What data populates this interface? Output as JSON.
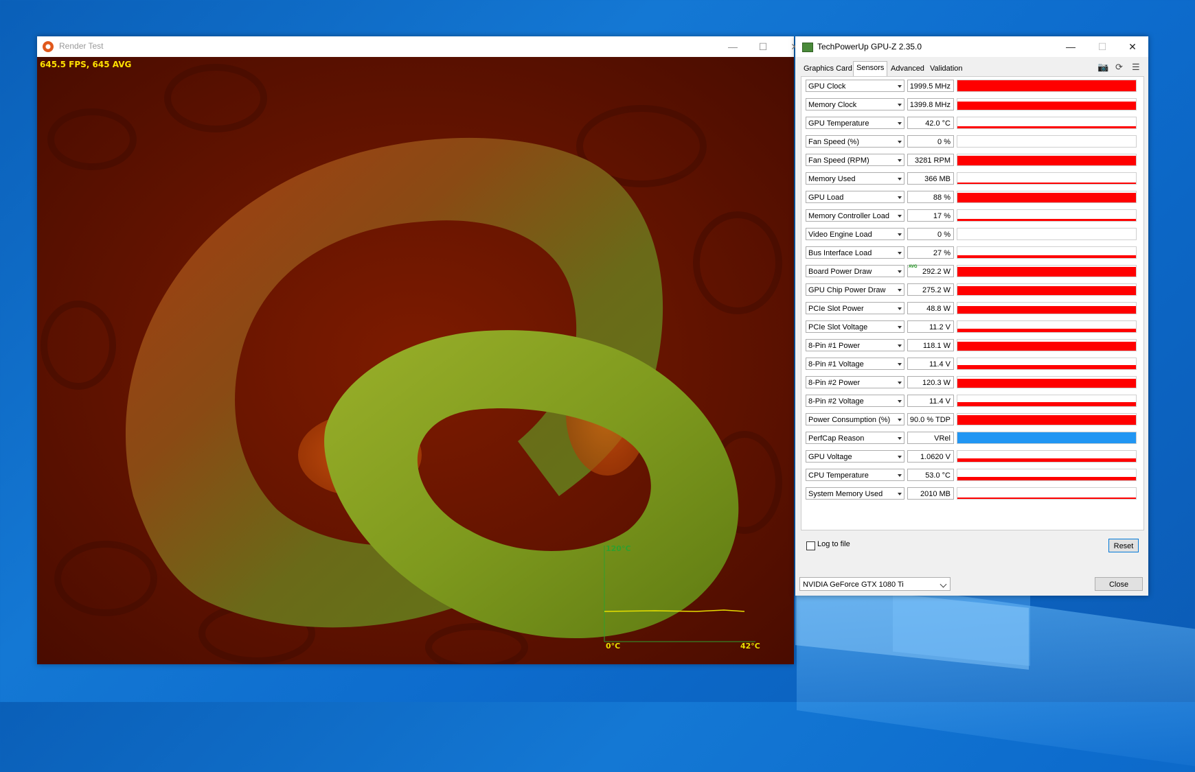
{
  "render_window": {
    "title": "Render Test",
    "fps_text": "645.5 FPS, 645 AVG",
    "graph_top_label": "120°C",
    "graph_bottom_left": "0°C",
    "graph_bottom_right": "42°C",
    "graph_line_color": "#e8e000",
    "axis_color": "#2ea02e"
  },
  "gpuz_window": {
    "title": "TechPowerUp GPU-Z 2.35.0",
    "tabs": [
      "Graphics Card",
      "Sensors",
      "Advanced",
      "Validation"
    ],
    "active_tab": "Sensors",
    "sensors": [
      {
        "name": "GPU Clock",
        "value": "1999.5 MHz",
        "level": 1.0
      },
      {
        "name": "Memory Clock",
        "value": "1399.8 MHz",
        "level": 0.75
      },
      {
        "name": "GPU Temperature",
        "value": "42.0 °C",
        "level": 0.2
      },
      {
        "name": "Fan Speed (%)",
        "value": "0 %",
        "level": 0.0
      },
      {
        "name": "Fan Speed (RPM)",
        "value": "3281 RPM",
        "level": 0.9
      },
      {
        "name": "Memory Used",
        "value": "366 MB",
        "level": 0.05
      },
      {
        "name": "GPU Load",
        "value": "88 %",
        "level": 0.88
      },
      {
        "name": "Memory Controller Load",
        "value": "17 %",
        "level": 0.17
      },
      {
        "name": "Video Engine Load",
        "value": "0 %",
        "level": 0.0
      },
      {
        "name": "Bus Interface Load",
        "value": "27 %",
        "level": 0.27
      },
      {
        "name": "Board Power Draw",
        "value": "292.2 W",
        "level": 0.85,
        "avg": "AVG"
      },
      {
        "name": "GPU Chip Power Draw",
        "value": "275.2 W",
        "level": 0.8
      },
      {
        "name": "PCIe Slot Power",
        "value": "48.8 W",
        "level": 0.7
      },
      {
        "name": "PCIe Slot Voltage",
        "value": "11.2 V",
        "level": 0.3
      },
      {
        "name": "8-Pin #1 Power",
        "value": "118.1 W",
        "level": 0.8
      },
      {
        "name": "8-Pin #1 Voltage",
        "value": "11.4 V",
        "level": 0.35
      },
      {
        "name": "8-Pin #2 Power",
        "value": "120.3 W",
        "level": 0.8
      },
      {
        "name": "8-Pin #2 Voltage",
        "value": "11.4 V",
        "level": 0.35
      },
      {
        "name": "Power Consumption (%)",
        "value": "90.0 % TDP",
        "level": 0.85
      },
      {
        "name": "PerfCap Reason",
        "value": "VRel",
        "level": 1.0,
        "color": "#2196f3"
      },
      {
        "name": "GPU Voltage",
        "value": "1.0620 V",
        "level": 0.3
      },
      {
        "name": "CPU Temperature",
        "value": "53.0 °C",
        "level": 0.3
      },
      {
        "name": "System Memory Used",
        "value": "2010 MB",
        "level": 0.15
      }
    ],
    "log_to_file_label": "Log to file",
    "reset_label": "Reset",
    "gpu_name": "NVIDIA GeForce GTX 1080 Ti",
    "close_label": "Close",
    "bar_color": "#ff0000"
  }
}
